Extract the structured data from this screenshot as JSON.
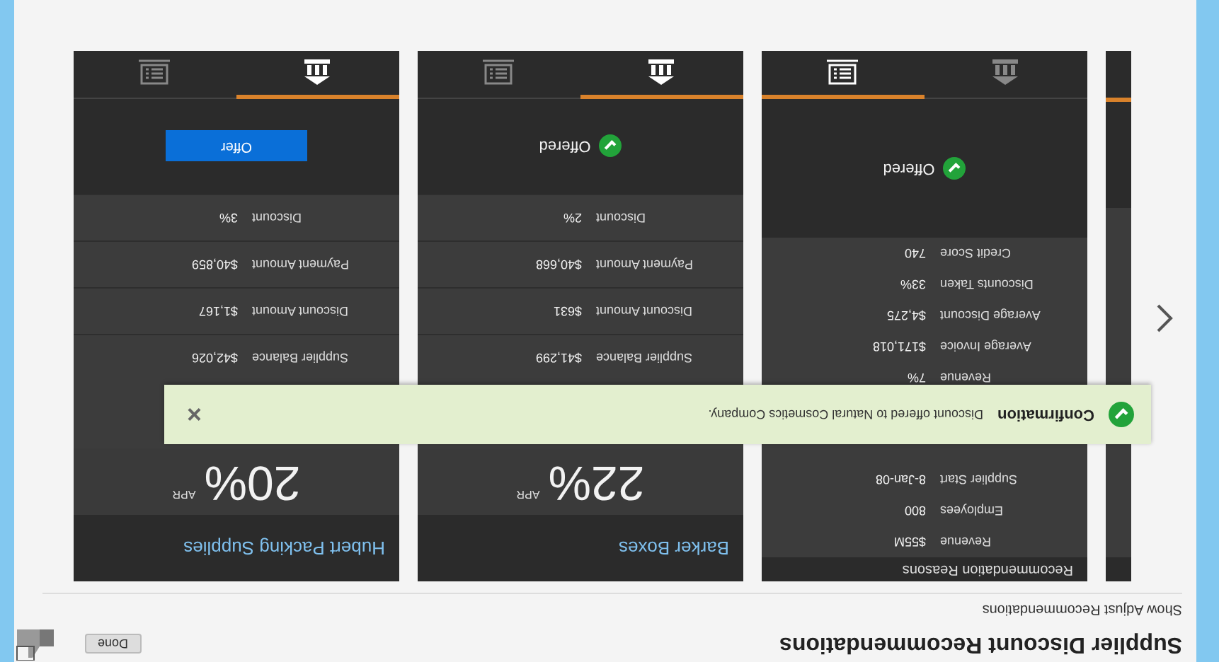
{
  "header": {
    "title": "Supplier Discount Recommendations",
    "button": "Done"
  },
  "link": "Show Adjust Recommendations",
  "cards": [
    {
      "kind": "reasons",
      "title": "Recommendation Reasons",
      "rows": [
        {
          "label": "Revenue",
          "value": "$55M"
        },
        {
          "label": "Employees",
          "value": "800"
        },
        {
          "label": "Supplier Start",
          "value": "8-Jan-08"
        },
        {
          "label": "Revenue",
          "value": "7%"
        },
        {
          "label": "Average Invoice",
          "value": "$171,018"
        },
        {
          "label": "Average Discount",
          "value": "$4,275"
        },
        {
          "label": "Discounts Taken",
          "value": "33%"
        },
        {
          "label": "Credit Score",
          "value": "740"
        }
      ],
      "status": {
        "kind": "offered",
        "label": "Offered"
      },
      "tabs": [
        {
          "selected": false
        },
        {
          "selected": true
        }
      ]
    },
    {
      "kind": "offer",
      "title": "Barker Boxes",
      "apr": "22%",
      "apr_label": "APR",
      "rows": [
        {
          "label": "Supplier Balance",
          "value": "$41,299"
        },
        {
          "label": "Discount Amount",
          "value": "$631"
        },
        {
          "label": "Payment Amount",
          "value": "$40,668"
        },
        {
          "label": "Discount",
          "value": "2%"
        }
      ],
      "status": {
        "kind": "offered",
        "label": "Offered"
      },
      "tabs": [
        {
          "selected": true
        },
        {
          "selected": false
        }
      ]
    },
    {
      "kind": "offer",
      "title": "Hubert Packing Supplies",
      "apr": "20%",
      "apr_label": "APR",
      "rows": [
        {
          "label": "Supplier Balance",
          "value": "$42,026"
        },
        {
          "label": "Discount Amount",
          "value": "$1,167"
        },
        {
          "label": "Payment Amount",
          "value": "$40,859"
        },
        {
          "label": "Discount",
          "value": "3%"
        }
      ],
      "status": {
        "kind": "button",
        "label": "Offer"
      },
      "tabs": [
        {
          "selected": true
        },
        {
          "selected": false
        }
      ]
    }
  ],
  "toast": {
    "title": "Confirmation",
    "message": "Discount offered to Natural Cosmetics Company.",
    "close": "×"
  }
}
